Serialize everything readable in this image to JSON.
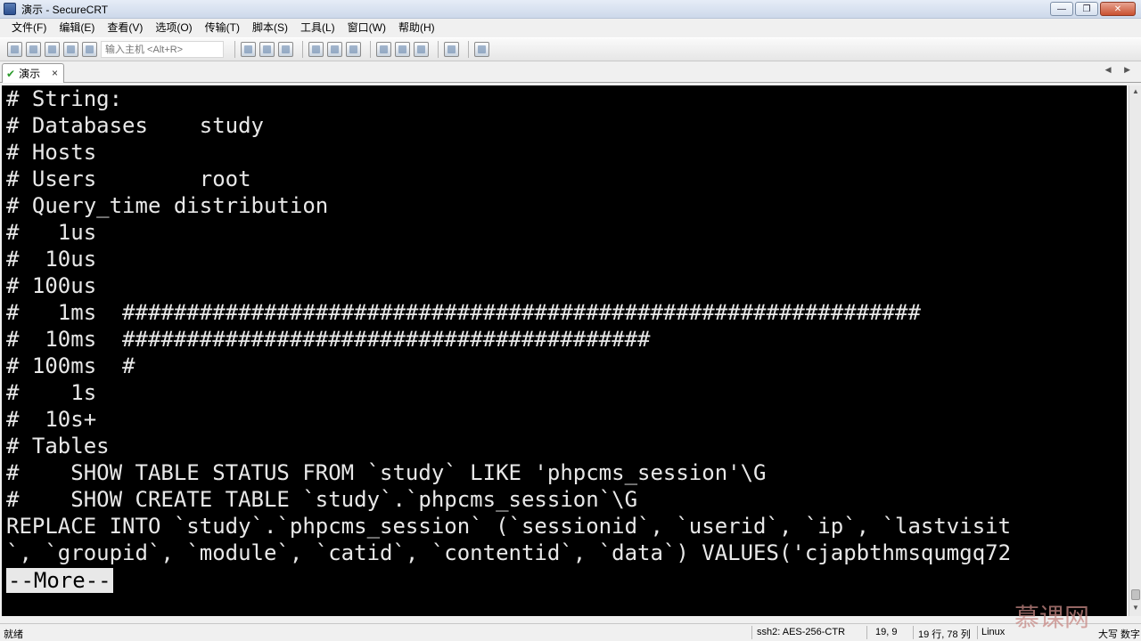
{
  "window": {
    "title": "演示 - SecureCRT"
  },
  "menu": [
    "文件(F)",
    "编辑(E)",
    "查看(V)",
    "选项(O)",
    "传输(T)",
    "脚本(S)",
    "工具(L)",
    "窗口(W)",
    "帮助(H)"
  ],
  "toolbar": {
    "host_placeholder": "输入主机 <Alt+R>",
    "icons_group1": [
      "connect-icon",
      "quick-connect-icon",
      "connect-tab-icon",
      "reconnect-icon",
      "disconnect-icon"
    ],
    "icons_group2": [
      "copy-icon",
      "paste-icon",
      "find-icon"
    ],
    "icons_group3": [
      "print-icon",
      "print-setup-icon",
      "print-preview-icon"
    ],
    "icons_group4": [
      "session-options-icon",
      "global-options-icon",
      "keymap-icon"
    ],
    "icons_group5": [
      "help-icon"
    ],
    "icons_group6": [
      "sftp-icon"
    ]
  },
  "tab": {
    "label": "演示",
    "close": "×",
    "nav": "◀ ▶"
  },
  "terminal": {
    "lines": [
      "# String:",
      "# Databases    study",
      "# Hosts",
      "# Users        root",
      "# Query_time distribution",
      "#   1us",
      "#  10us",
      "# 100us",
      "#   1ms  ##############################################################",
      "#  10ms  #########################################",
      "# 100ms  #",
      "#    1s",
      "#  10s+",
      "# Tables",
      "#    SHOW TABLE STATUS FROM `study` LIKE 'phpcms_session'\\G",
      "#    SHOW CREATE TABLE `study`.`phpcms_session`\\G",
      "REPLACE INTO `study`.`phpcms_session` (`sessionid`, `userid`, `ip`, `lastvisit",
      "`, `groupid`, `module`, `catid`, `contentid`, `data`) VALUES('cjapbthmsqumgq72"
    ],
    "more_prompt": "--More--"
  },
  "status": {
    "ready": "就绪",
    "cipher": "ssh2: AES-256-CTR",
    "cursor": "19,   9",
    "size": "19 行, 78 列",
    "os": "Linux",
    "caps": "大写",
    "num": "数字"
  },
  "watermark": "慕课网"
}
